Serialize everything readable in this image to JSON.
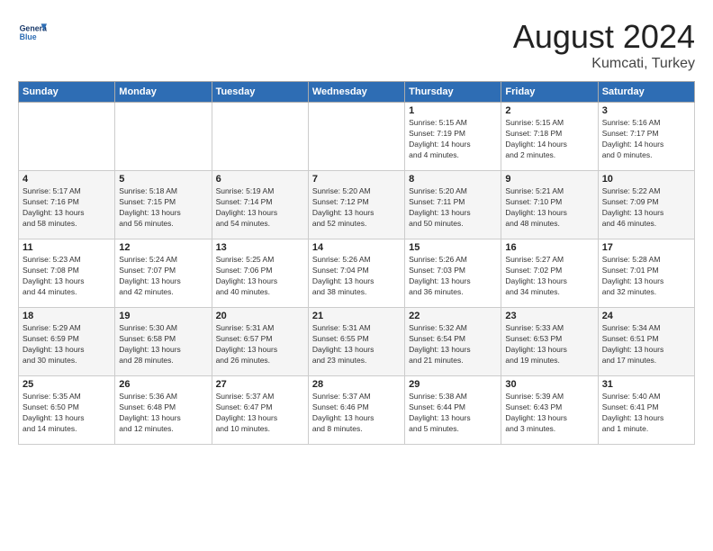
{
  "logo": {
    "text_general": "General",
    "text_blue": "Blue"
  },
  "header": {
    "month_year": "August 2024",
    "location": "Kumcati, Turkey"
  },
  "days_of_week": [
    "Sunday",
    "Monday",
    "Tuesday",
    "Wednesday",
    "Thursday",
    "Friday",
    "Saturday"
  ],
  "weeks": [
    [
      {
        "day": "",
        "info": ""
      },
      {
        "day": "",
        "info": ""
      },
      {
        "day": "",
        "info": ""
      },
      {
        "day": "",
        "info": ""
      },
      {
        "day": "1",
        "info": "Sunrise: 5:15 AM\nSunset: 7:19 PM\nDaylight: 14 hours\nand 4 minutes."
      },
      {
        "day": "2",
        "info": "Sunrise: 5:15 AM\nSunset: 7:18 PM\nDaylight: 14 hours\nand 2 minutes."
      },
      {
        "day": "3",
        "info": "Sunrise: 5:16 AM\nSunset: 7:17 PM\nDaylight: 14 hours\nand 0 minutes."
      }
    ],
    [
      {
        "day": "4",
        "info": "Sunrise: 5:17 AM\nSunset: 7:16 PM\nDaylight: 13 hours\nand 58 minutes."
      },
      {
        "day": "5",
        "info": "Sunrise: 5:18 AM\nSunset: 7:15 PM\nDaylight: 13 hours\nand 56 minutes."
      },
      {
        "day": "6",
        "info": "Sunrise: 5:19 AM\nSunset: 7:14 PM\nDaylight: 13 hours\nand 54 minutes."
      },
      {
        "day": "7",
        "info": "Sunrise: 5:20 AM\nSunset: 7:12 PM\nDaylight: 13 hours\nand 52 minutes."
      },
      {
        "day": "8",
        "info": "Sunrise: 5:20 AM\nSunset: 7:11 PM\nDaylight: 13 hours\nand 50 minutes."
      },
      {
        "day": "9",
        "info": "Sunrise: 5:21 AM\nSunset: 7:10 PM\nDaylight: 13 hours\nand 48 minutes."
      },
      {
        "day": "10",
        "info": "Sunrise: 5:22 AM\nSunset: 7:09 PM\nDaylight: 13 hours\nand 46 minutes."
      }
    ],
    [
      {
        "day": "11",
        "info": "Sunrise: 5:23 AM\nSunset: 7:08 PM\nDaylight: 13 hours\nand 44 minutes."
      },
      {
        "day": "12",
        "info": "Sunrise: 5:24 AM\nSunset: 7:07 PM\nDaylight: 13 hours\nand 42 minutes."
      },
      {
        "day": "13",
        "info": "Sunrise: 5:25 AM\nSunset: 7:06 PM\nDaylight: 13 hours\nand 40 minutes."
      },
      {
        "day": "14",
        "info": "Sunrise: 5:26 AM\nSunset: 7:04 PM\nDaylight: 13 hours\nand 38 minutes."
      },
      {
        "day": "15",
        "info": "Sunrise: 5:26 AM\nSunset: 7:03 PM\nDaylight: 13 hours\nand 36 minutes."
      },
      {
        "day": "16",
        "info": "Sunrise: 5:27 AM\nSunset: 7:02 PM\nDaylight: 13 hours\nand 34 minutes."
      },
      {
        "day": "17",
        "info": "Sunrise: 5:28 AM\nSunset: 7:01 PM\nDaylight: 13 hours\nand 32 minutes."
      }
    ],
    [
      {
        "day": "18",
        "info": "Sunrise: 5:29 AM\nSunset: 6:59 PM\nDaylight: 13 hours\nand 30 minutes."
      },
      {
        "day": "19",
        "info": "Sunrise: 5:30 AM\nSunset: 6:58 PM\nDaylight: 13 hours\nand 28 minutes."
      },
      {
        "day": "20",
        "info": "Sunrise: 5:31 AM\nSunset: 6:57 PM\nDaylight: 13 hours\nand 26 minutes."
      },
      {
        "day": "21",
        "info": "Sunrise: 5:31 AM\nSunset: 6:55 PM\nDaylight: 13 hours\nand 23 minutes."
      },
      {
        "day": "22",
        "info": "Sunrise: 5:32 AM\nSunset: 6:54 PM\nDaylight: 13 hours\nand 21 minutes."
      },
      {
        "day": "23",
        "info": "Sunrise: 5:33 AM\nSunset: 6:53 PM\nDaylight: 13 hours\nand 19 minutes."
      },
      {
        "day": "24",
        "info": "Sunrise: 5:34 AM\nSunset: 6:51 PM\nDaylight: 13 hours\nand 17 minutes."
      }
    ],
    [
      {
        "day": "25",
        "info": "Sunrise: 5:35 AM\nSunset: 6:50 PM\nDaylight: 13 hours\nand 14 minutes."
      },
      {
        "day": "26",
        "info": "Sunrise: 5:36 AM\nSunset: 6:48 PM\nDaylight: 13 hours\nand 12 minutes."
      },
      {
        "day": "27",
        "info": "Sunrise: 5:37 AM\nSunset: 6:47 PM\nDaylight: 13 hours\nand 10 minutes."
      },
      {
        "day": "28",
        "info": "Sunrise: 5:37 AM\nSunset: 6:46 PM\nDaylight: 13 hours\nand 8 minutes."
      },
      {
        "day": "29",
        "info": "Sunrise: 5:38 AM\nSunset: 6:44 PM\nDaylight: 13 hours\nand 5 minutes."
      },
      {
        "day": "30",
        "info": "Sunrise: 5:39 AM\nSunset: 6:43 PM\nDaylight: 13 hours\nand 3 minutes."
      },
      {
        "day": "31",
        "info": "Sunrise: 5:40 AM\nSunset: 6:41 PM\nDaylight: 13 hours\nand 1 minute."
      }
    ]
  ]
}
